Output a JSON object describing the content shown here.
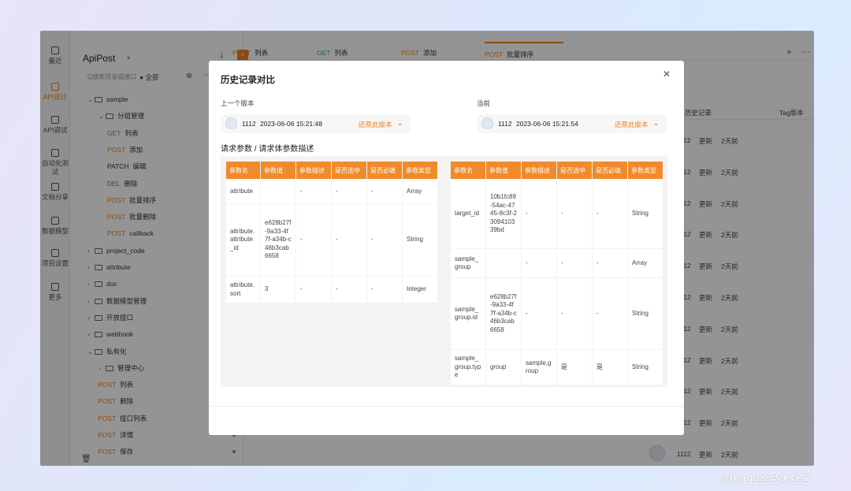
{
  "rail": [
    {
      "label": "最近",
      "icon": "clock-icon",
      "active": false
    },
    {
      "label": "API设计",
      "icon": "api-design-icon",
      "active": true
    },
    {
      "label": "API调试",
      "icon": "api-debug-icon",
      "active": false
    },
    {
      "label": "自动化测试",
      "icon": "automation-test-icon",
      "active": false
    },
    {
      "label": "文档分享",
      "icon": "doc-share-icon",
      "active": false
    },
    {
      "label": "数据模型",
      "icon": "data-model-icon",
      "active": false
    },
    {
      "label": "项目设置",
      "icon": "project-settings-icon",
      "active": false
    },
    {
      "label": "更多",
      "icon": "more-icon",
      "active": false
    }
  ],
  "sidebar": {
    "project": "ApiPost",
    "search_placeholder": "Q搜索目录或接口",
    "filter": "● 全部",
    "tree": [
      {
        "method": "",
        "label": "sample",
        "type": "folder-open"
      },
      {
        "method": "",
        "label": "分组管理",
        "type": "folder-open"
      },
      {
        "method": "GET",
        "label": "列表",
        "type": "api"
      },
      {
        "method": "POST",
        "label": "添加",
        "type": "api"
      },
      {
        "method": "PATCH",
        "label": "编辑",
        "type": "api"
      },
      {
        "method": "DEL",
        "label": "删除",
        "type": "api"
      },
      {
        "method": "POST",
        "label": "批量排序",
        "type": "api"
      },
      {
        "method": "POST",
        "label": "批量删除",
        "type": "api"
      },
      {
        "method": "POST",
        "label": "callback",
        "type": "api"
      },
      {
        "method": "",
        "label": "project_code",
        "type": "folder"
      },
      {
        "method": "",
        "label": "attribute",
        "type": "folder"
      },
      {
        "method": "",
        "label": "doc",
        "type": "folder"
      },
      {
        "method": "",
        "label": "数据模型管理",
        "type": "folder"
      },
      {
        "method": "",
        "label": "开放接口",
        "type": "folder"
      },
      {
        "method": "",
        "label": "webhook",
        "type": "folder"
      },
      {
        "method": "",
        "label": "私有化",
        "type": "folder-open"
      },
      {
        "method": "",
        "label": "管理中心",
        "type": "folder"
      },
      {
        "method": "POST",
        "label": "列表",
        "type": "api"
      },
      {
        "method": "POST",
        "label": "删除",
        "type": "api"
      },
      {
        "method": "POST",
        "label": "接口列表",
        "type": "api"
      },
      {
        "method": "POST",
        "label": "详情",
        "type": "api"
      },
      {
        "method": "POST",
        "label": "保存",
        "type": "api"
      }
    ]
  },
  "tabs": [
    {
      "method": "POST",
      "label": "列表"
    },
    {
      "method": "GET",
      "label": "列表"
    },
    {
      "method": "POST",
      "label": "添加"
    },
    {
      "method": "POST",
      "label": "批量排序"
    }
  ],
  "history": {
    "header_a": "历史记录",
    "header_b": "Tag版本",
    "rows": [
      {
        "id": "1112",
        "action": "更新",
        "time": "2天前"
      },
      {
        "id": "1112",
        "action": "更新",
        "time": "2天前"
      },
      {
        "id": "1112",
        "action": "更新",
        "time": "2天前"
      },
      {
        "id": "1112",
        "action": "更新",
        "time": "2天前"
      },
      {
        "id": "1112",
        "action": "更新",
        "time": "2天前"
      },
      {
        "id": "1112",
        "action": "更新",
        "time": "2天前"
      },
      {
        "id": "1112",
        "action": "更新",
        "time": "2天前"
      },
      {
        "id": "1112",
        "action": "更新",
        "time": "2天前"
      },
      {
        "id": "1112",
        "action": "更新",
        "time": "2天前"
      },
      {
        "id": "1112",
        "action": "更新",
        "time": "2天前"
      },
      {
        "id": "1112",
        "action": "更新",
        "time": "2天前"
      }
    ]
  },
  "modal": {
    "title": "历史记录对比",
    "prev_label": "上一个版本",
    "curr_label": "当前",
    "prev": {
      "id": "1112",
      "time": "2023-06-06 15:21:48",
      "restore": "还原此版本"
    },
    "curr": {
      "id": "1112",
      "time": "2023-06-06 15:21:54",
      "restore": "还原此版本"
    },
    "section": "请求参数 / 请求体参数描述",
    "columns": [
      "参数名",
      "参数值",
      "参数描述",
      "是否选中",
      "是否必填",
      "参数类型"
    ],
    "left_rows": [
      [
        "attribute",
        "",
        "-",
        "-",
        "-",
        "Array"
      ],
      [
        "attribute.attribute_id",
        "e628b27f-9a33-4f7f-a34b-c46b3cab6658",
        "-",
        "-",
        "-",
        "String"
      ],
      [
        "attribute.sort",
        "3",
        "-",
        "-",
        "-",
        "Integer"
      ]
    ],
    "right_rows": [
      [
        "target_id",
        "10b1fc89-54ac-4745-8c3f-2309410339bd",
        "-",
        "-",
        "-",
        "String"
      ],
      [
        "sample_group",
        "",
        "-",
        "-",
        "-",
        "Array"
      ],
      [
        "sample_group.id",
        "e628b27f-9a33-4f7f-a34b-c46b3cab6658",
        "-",
        "-",
        "-",
        "String"
      ],
      [
        "sample_group.type",
        "group",
        "sample,group",
        "是",
        "是",
        "String"
      ]
    ]
  },
  "watermark": "@稀土掘金技术社区",
  "colors": {
    "accent": "#f07f1a",
    "get": "#34b26e",
    "delete": "#e54545"
  }
}
